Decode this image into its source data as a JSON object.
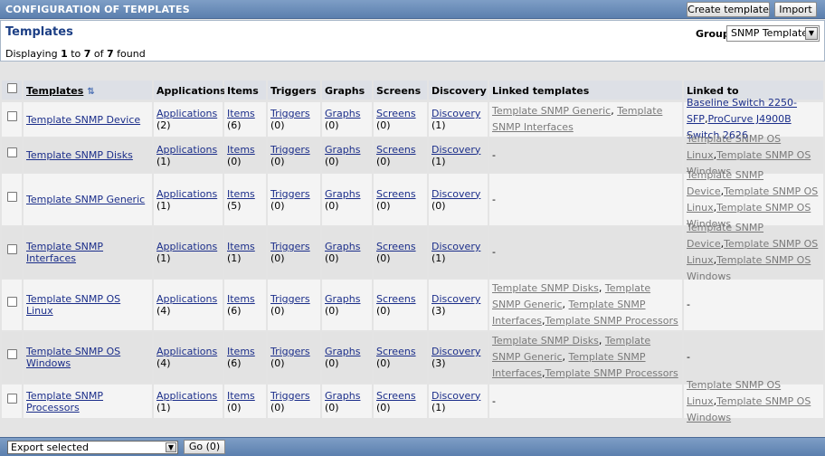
{
  "header": {
    "title": "CONFIGURATION OF TEMPLATES",
    "create_label": "Create template",
    "import_label": "Import"
  },
  "panel": {
    "title": "Templates",
    "group_label": "Group",
    "group_value": "SNMP Templates",
    "count_prefix": "Displaying ",
    "count_from": "1",
    "count_to_word": " to ",
    "count_to": "7",
    "count_of_word": " of ",
    "count_total": "7",
    "count_suffix": " found"
  },
  "columns": [
    "Templates",
    "Applications",
    "Items",
    "Triggers",
    "Graphs",
    "Screens",
    "Discovery",
    "Linked templates",
    "Linked to"
  ],
  "rows": [
    {
      "name": "Template SNMP Device",
      "applications": "(2)",
      "items": "(6)",
      "triggers": "(0)",
      "graphs": "(0)",
      "screens": "(0)",
      "discovery": "(1)",
      "linked_templates": [
        [
          "Template SNMP Generic",
          ", "
        ],
        [
          "Template SNMP Interfaces",
          ""
        ]
      ],
      "linked_to": [
        [
          "Baseline Switch 2250-SFP",
          ","
        ],
        [
          "ProCurve J4900B Switch 2626",
          ""
        ]
      ]
    },
    {
      "name": "Template SNMP Disks",
      "applications": "(1)",
      "items": "(0)",
      "triggers": "(0)",
      "graphs": "(0)",
      "screens": "(0)",
      "discovery": "(1)",
      "linked_templates_dash": "-",
      "linked_to": [
        [
          "Template SNMP OS Linux",
          ","
        ],
        [
          "Template SNMP OS Windows",
          ""
        ]
      ]
    },
    {
      "name": "Template SNMP Generic",
      "applications": "(1)",
      "items": "(5)",
      "triggers": "(0)",
      "graphs": "(0)",
      "screens": "(0)",
      "discovery": "(0)",
      "linked_templates_dash": "-",
      "linked_to": [
        [
          "Template SNMP Device",
          ","
        ],
        [
          "Template SNMP OS Linux",
          ","
        ],
        [
          "Template SNMP OS Windows",
          ""
        ]
      ]
    },
    {
      "name": "Template SNMP Interfaces",
      "applications": "(1)",
      "items": "(1)",
      "triggers": "(0)",
      "graphs": "(0)",
      "screens": "(0)",
      "discovery": "(1)",
      "linked_templates_dash": "-",
      "linked_to": [
        [
          "Template SNMP Device",
          ","
        ],
        [
          "Template SNMP OS Linux",
          ","
        ],
        [
          "Template SNMP OS Windows",
          ""
        ]
      ]
    },
    {
      "name": "Template SNMP OS Linux",
      "applications": "(4)",
      "items": "(6)",
      "triggers": "(0)",
      "graphs": "(0)",
      "screens": "(0)",
      "discovery": "(3)",
      "linked_templates": [
        [
          "Template SNMP Disks",
          ", "
        ],
        [
          "Template SNMP Generic",
          ", "
        ],
        [
          "Template SNMP Interfaces",
          ","
        ],
        [
          "Template SNMP Processors",
          ""
        ]
      ],
      "linked_to_dash": "-"
    },
    {
      "name": "Template SNMP OS Windows",
      "applications": "(4)",
      "items": "(6)",
      "triggers": "(0)",
      "graphs": "(0)",
      "screens": "(0)",
      "discovery": "(3)",
      "linked_templates": [
        [
          "Template SNMP Disks",
          ", "
        ],
        [
          "Template SNMP Generic",
          ", "
        ],
        [
          "Template SNMP Interfaces",
          ","
        ],
        [
          "Template SNMP Processors",
          ""
        ]
      ],
      "linked_to_dash": "-"
    },
    {
      "name": "Template SNMP Processors",
      "applications": "(1)",
      "items": "(0)",
      "triggers": "(0)",
      "graphs": "(0)",
      "screens": "(0)",
      "discovery": "(1)",
      "linked_templates_dash": "-",
      "linked_to": [
        [
          "Template SNMP OS Linux",
          ","
        ],
        [
          "Template SNMP OS Windows",
          ""
        ]
      ]
    }
  ],
  "link_words": {
    "applications": "Applications",
    "items": "Items",
    "triggers": "Triggers",
    "graphs": "Graphs",
    "screens": "Screens",
    "discovery": "Discovery"
  },
  "footer": {
    "action_value": "Export selected",
    "go_label": "Go (0)"
  },
  "icons": {
    "sort": "sort-asc-icon",
    "select_arrow": "chevron-down-icon"
  },
  "colors": {
    "header_bar": "#5b7fae",
    "link": "#1b2e8a",
    "link_gray": "#7a7a7a",
    "title": "#1c3f85"
  }
}
